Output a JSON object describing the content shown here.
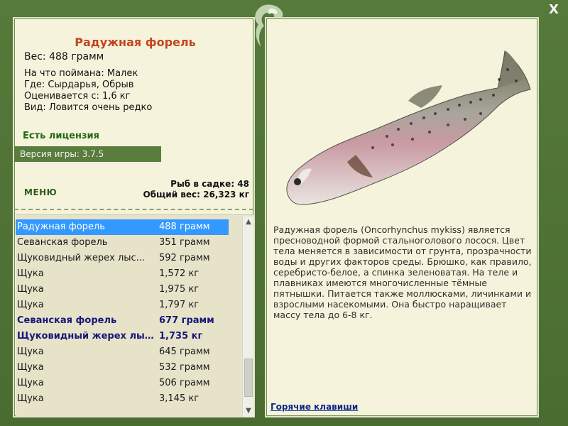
{
  "window": {
    "close_symbol": "X"
  },
  "fish": {
    "title": "Радужная форель",
    "weight_line": "Вес: 488 грамм",
    "caught_on": "На что поймана: Малек",
    "where": "Где: Сырдарья, Обрыв",
    "valued_from": "Оценивается с: 1,6 кг",
    "kind": "Вид: Ловится очень редко"
  },
  "license_text": "Есть лицензия",
  "version_text": "Версия игры: 3.7.5",
  "menu_label": "МЕНЮ",
  "stats": {
    "fish_in_cage": "Рыб в садке: 48",
    "total_weight": "Общий вес: 26,323 кг"
  },
  "catch_list": [
    {
      "name": "Радужная форель",
      "weight": "488 грамм",
      "state": "selected"
    },
    {
      "name": "Севанская форель",
      "weight": "351 грамм",
      "state": "normal"
    },
    {
      "name": "Щуковидный жерех лыс...",
      "weight": "592 грамм",
      "state": "normal"
    },
    {
      "name": "Щука",
      "weight": "1,572 кг",
      "state": "normal"
    },
    {
      "name": "Щука",
      "weight": "1,975 кг",
      "state": "normal"
    },
    {
      "name": "Щука",
      "weight": "1,797 кг",
      "state": "normal"
    },
    {
      "name": "Севанская форель",
      "weight": "677 грамм",
      "state": "bold"
    },
    {
      "name": "Щуковидный жерех лыс...",
      "weight": "1,735 кг",
      "state": "bold"
    },
    {
      "name": "Щука",
      "weight": "645 грамм",
      "state": "normal"
    },
    {
      "name": "Щука",
      "weight": "532 грамм",
      "state": "normal"
    },
    {
      "name": "Щука",
      "weight": "506 грамм",
      "state": "normal"
    },
    {
      "name": "Щука",
      "weight": "3,145 кг",
      "state": "normal"
    }
  ],
  "description": "Радужная форель (Oncorhynchus mykiss) является пресноводной формой стальноголового лосося. Цвет тела меняется в зависимости от грунта, прозрачности воды и других факторов среды. Брюшко, как правило, серебристо-белое, а спинка зеленоватая. На теле и плавниках имеются многочисленные тёмные пятнышки. Питается также моллюсками, личинками и взрослыми насекомыми. Она быстро наращивает массу тела до 6-8 кг.",
  "hotkeys_label": "Горячие клавиши",
  "colors": {
    "frame": "#4c6d34",
    "panel": "#f6f3dd",
    "title": "#c4441a",
    "license": "#1f6a12",
    "selected": "#3399ff",
    "bold_row": "#17177a",
    "link": "#0c2a8a"
  },
  "icons": [
    "fish-logo-icon",
    "close-icon",
    "scroll-up-icon",
    "scroll-down-icon"
  ]
}
